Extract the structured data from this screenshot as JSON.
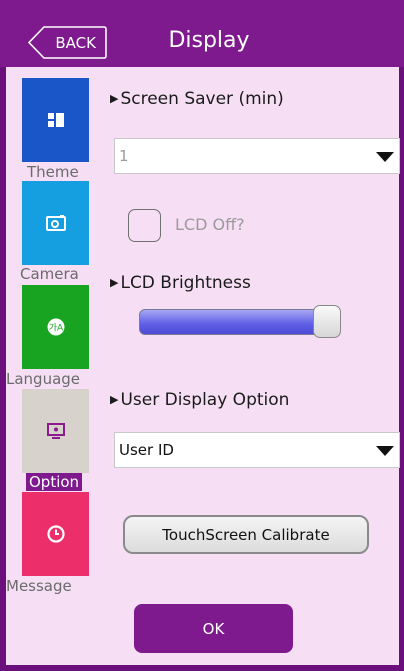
{
  "header": {
    "back_label": "BACK",
    "title": "Display"
  },
  "sidebar": {
    "items": [
      {
        "label": "Theme",
        "icon": "grid-icon",
        "color": "#1b56c8"
      },
      {
        "label": "Camera",
        "icon": "camera-icon",
        "color": "#159fe0"
      },
      {
        "label": "Language",
        "icon": "globe-icon",
        "color": "#18a320"
      },
      {
        "label": "Option",
        "icon": "monitor-icon",
        "color": "#d7d3cc",
        "selected": true
      },
      {
        "label": "Message",
        "icon": "clock-icon",
        "color": "#ec2f6b"
      }
    ]
  },
  "content": {
    "screen_saver": {
      "label": "Screen Saver (min)",
      "value": "1"
    },
    "lcd_off": {
      "label": "LCD Off?",
      "checked": false
    },
    "lcd_brightness": {
      "label": "LCD Brightness",
      "level_percent": 100
    },
    "user_display": {
      "label": "User Display Option",
      "value": "User ID"
    },
    "calibrate_label": "TouchScreen Calibrate",
    "ok_label": "OK"
  },
  "colors": {
    "header": "#7e1a8e",
    "panel": "#f6dff4",
    "accent": "#7e1a8e"
  }
}
